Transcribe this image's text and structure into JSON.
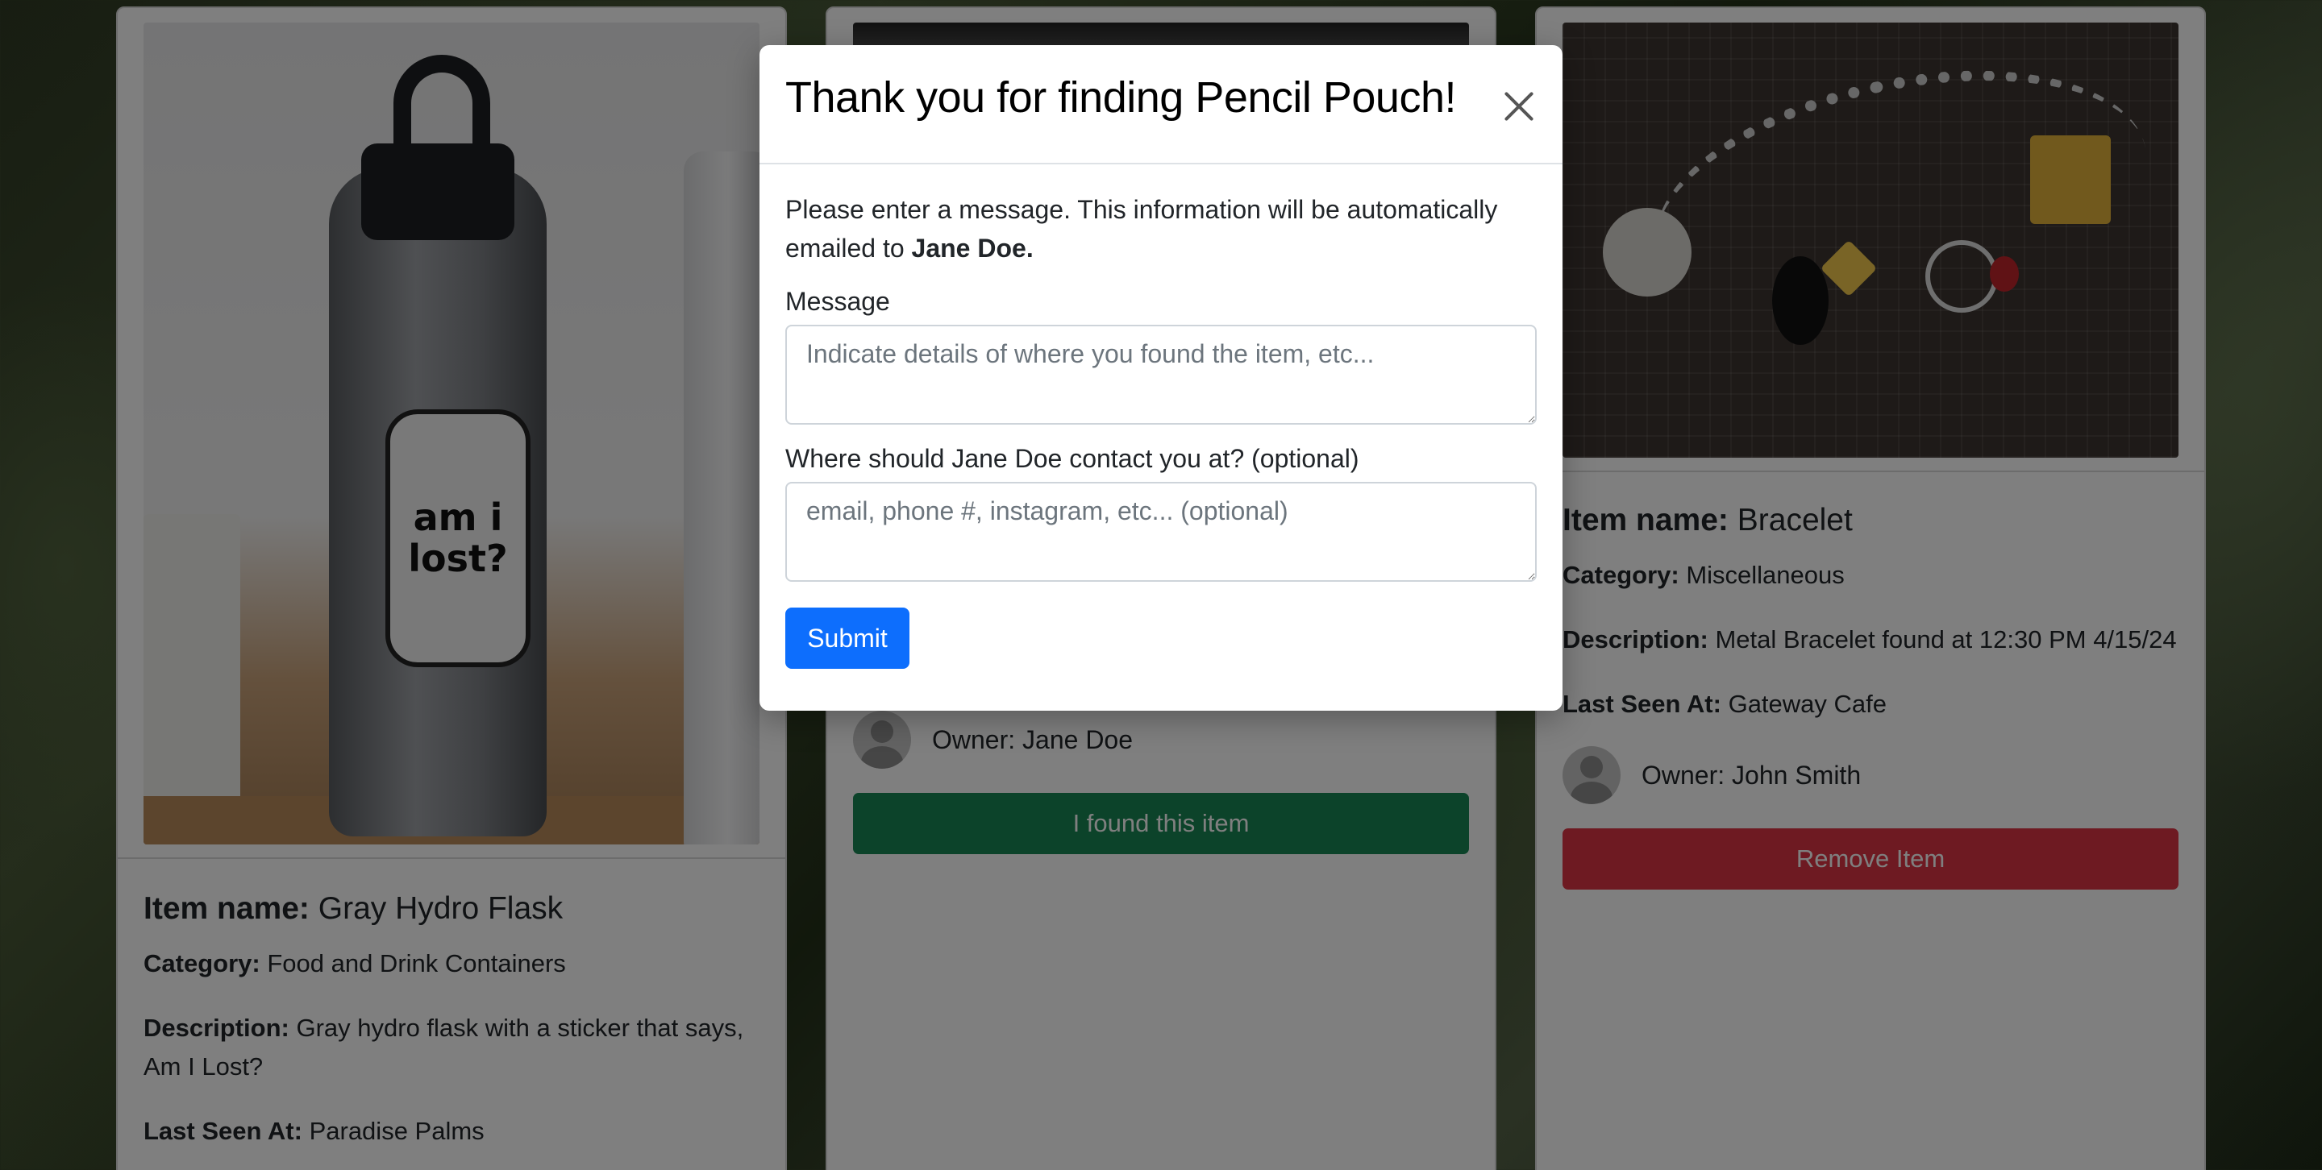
{
  "cards": [
    {
      "item_label": "Item name:",
      "item_name": "Gray Hydro Flask",
      "category_label": "Category:",
      "category": "Food and Drink Containers",
      "description_label": "Description:",
      "description": "Gray hydro flask with a sticker that says, Am I Lost?",
      "last_seen_label": "Last Seen At:",
      "last_seen": "Paradise Palms",
      "sticker_text": "am i lost?"
    },
    {
      "owner": "Owner: Jane Doe",
      "action": "I found this item",
      "action_color": "#198754"
    },
    {
      "item_label": "Item name:",
      "item_name": "Bracelet",
      "category_label": "Category:",
      "category": "Miscellaneous",
      "description_label": "Description:",
      "description": "Metal Bracelet found at 12:30 PM 4/15/24",
      "last_seen_label": "Last Seen At:",
      "last_seen": "Gateway Cafe",
      "owner": "Owner: John Smith",
      "action": "Remove Item",
      "action_color": "#dc3545"
    }
  ],
  "modal": {
    "title": "Thank you for finding Pencil Pouch!",
    "intro_text": "Please enter a message. This information will be automatically emailed to ",
    "recipient": "Jane Doe.",
    "message_label": "Message",
    "message_placeholder": "Indicate details of where you found the item, etc...",
    "contact_label": "Where should Jane Doe contact you at? (optional)",
    "contact_placeholder": "email, phone #, instagram, etc... (optional)",
    "submit_label": "Submit",
    "submit_color": "#0d6efd"
  }
}
